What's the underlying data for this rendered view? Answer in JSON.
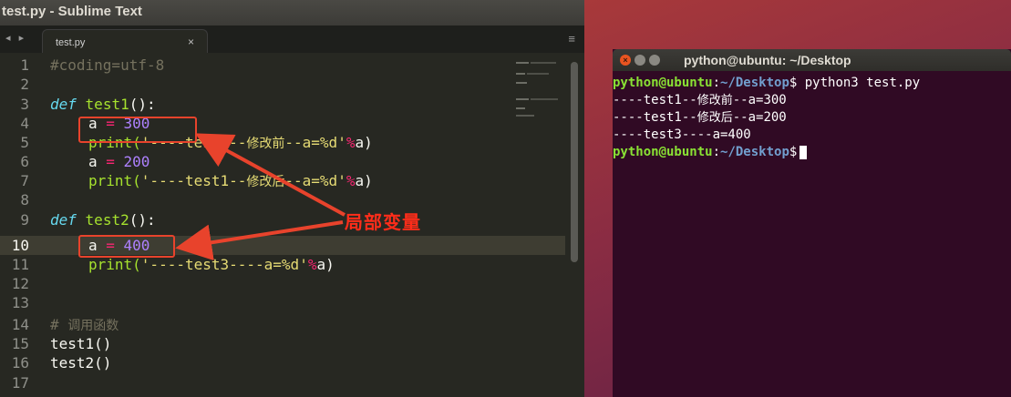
{
  "sublime": {
    "window_title": "test.py - Sublime Text",
    "tab_label": "test.py",
    "tab_close": "×",
    "menu_icon": "≡",
    "nav_arrows": "◂ ▸",
    "line_numbers": [
      "1",
      "2",
      "3",
      "4",
      "5",
      "6",
      "7",
      "8",
      "9",
      "10",
      "11",
      "12",
      "13",
      "14",
      "15",
      "16",
      "17"
    ],
    "active_line": "10",
    "code": {
      "l1": "#coding=utf-8",
      "l3_def": "def",
      "l3_fn": "test1",
      "l3_tail": "():",
      "l4_a": "a ",
      "l4_eq": "=",
      "l4_num": " 300",
      "l5_print": "print(",
      "l5_str1": "'----test1--",
      "l5_cjk": "修改前",
      "l5_str2": "--a=%d'",
      "l5_op": "%",
      "l5_tail": "a)",
      "l6_a": "a ",
      "l6_eq": "=",
      "l6_num": " 200",
      "l7_print": "print(",
      "l7_str1": "'----test1--",
      "l7_cjk": "修改后",
      "l7_str2": "--a=%d'",
      "l7_op": "%",
      "l7_tail": "a)",
      "l9_def": "def",
      "l9_fn": "test2",
      "l9_tail": "():",
      "l10_a": "a ",
      "l10_eq": "=",
      "l10_num": " 400",
      "l11_print": "print(",
      "l11_str": "'----test3----a=%d'",
      "l11_op": "%",
      "l11_tail": "a)",
      "l14_hash": "# ",
      "l14_cjk": "调用函数",
      "l15": "test1()",
      "l16": "test2()"
    },
    "annotation": "局部变量",
    "annotation_color": "#ff2d1a"
  },
  "terminal": {
    "title": "python@ubuntu: ~/Desktop",
    "lines": {
      "l1_user": "python@ubuntu",
      "l1_colon": ":",
      "l1_path": "~/Desktop",
      "l1_cmd": "$ python3 test.py",
      "l2_a": "----test1--",
      "l2_cjk": "修改前",
      "l2_b": "--a=300",
      "l3_a": "----test1--",
      "l3_cjk": "修改后",
      "l3_b": "--a=200",
      "l4": "----test3----a=400",
      "l5_user": "python@ubuntu",
      "l5_colon": ":",
      "l5_path": "~/Desktop",
      "l5_prompt": "$"
    },
    "colors": {
      "background": "#300a24",
      "user": "#8ae234",
      "path": "#729fcf"
    }
  },
  "icons": [
    "close-icon",
    "minimize-icon",
    "maximize-icon",
    "menu-icon",
    "tab-close-icon"
  ]
}
